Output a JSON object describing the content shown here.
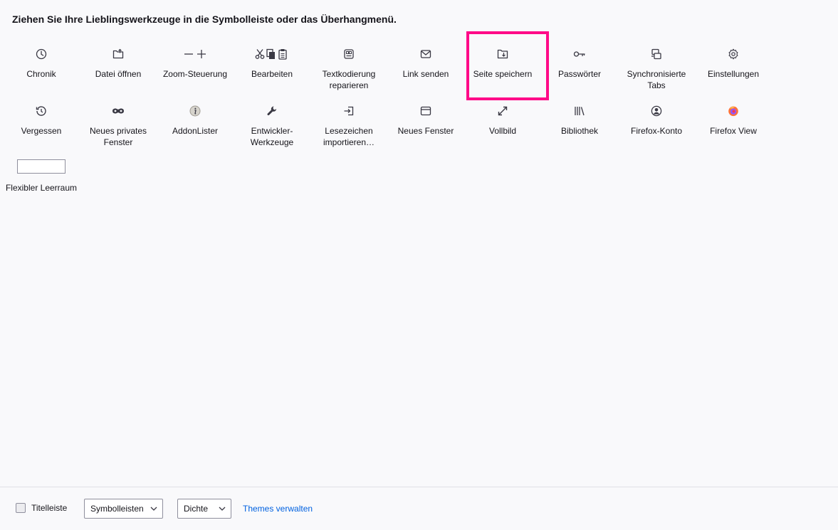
{
  "heading": "Ziehen Sie Ihre Lieblingswerkzeuge in die Symbolleiste oder das Überhangmenü.",
  "rows": [
    [
      {
        "label": "Chronik",
        "icon": "clock-icon"
      },
      {
        "label": "Datei öffnen",
        "icon": "open-file-icon"
      },
      {
        "label": "Zoom-Steuerung",
        "icon": "zoom-icon"
      },
      {
        "label": "Bearbeiten",
        "icon": "cut-copy-paste-icon"
      },
      {
        "label": "Textkodierung reparieren",
        "icon": "text-encoding-icon"
      },
      {
        "label": "Link senden",
        "icon": "mail-icon"
      },
      {
        "label": "Seite speichern",
        "icon": "save-page-icon"
      },
      {
        "label": "Passwörter",
        "icon": "key-icon"
      },
      {
        "label": "Synchronisierte Tabs",
        "icon": "synced-tabs-icon"
      },
      {
        "label": "Einstellungen",
        "icon": "gear-icon"
      }
    ],
    [
      {
        "label": "Vergessen",
        "icon": "forget-icon"
      },
      {
        "label": "Neues privates Fenster",
        "icon": "private-mask-icon"
      },
      {
        "label": "AddonLister",
        "icon": "info-icon"
      },
      {
        "label": "Entwickler-Werkzeuge",
        "icon": "wrench-icon"
      },
      {
        "label": "Lesezeichen importieren…",
        "icon": "import-icon"
      },
      {
        "label": "Neues Fenster",
        "icon": "new-window-icon"
      },
      {
        "label": "Vollbild",
        "icon": "fullscreen-icon"
      },
      {
        "label": "Bibliothek",
        "icon": "library-icon"
      },
      {
        "label": "Firefox-Konto",
        "icon": "account-icon"
      },
      {
        "label": "Firefox View",
        "icon": "firefox-icon"
      }
    ],
    [
      {
        "label": "Flexibler Leerraum",
        "icon": "flexible-space"
      }
    ]
  ],
  "highlighted_item": "Seite speichern",
  "footer": {
    "titlebar_label": "Titelleiste",
    "titlebar_checked": false,
    "toolbars_label": "Symbolleisten",
    "density_label": "Dichte",
    "themes_link": "Themes verwalten"
  },
  "colors": {
    "highlight": "#ff0a88",
    "link": "#0061e0",
    "background": "#f9f9fb"
  }
}
